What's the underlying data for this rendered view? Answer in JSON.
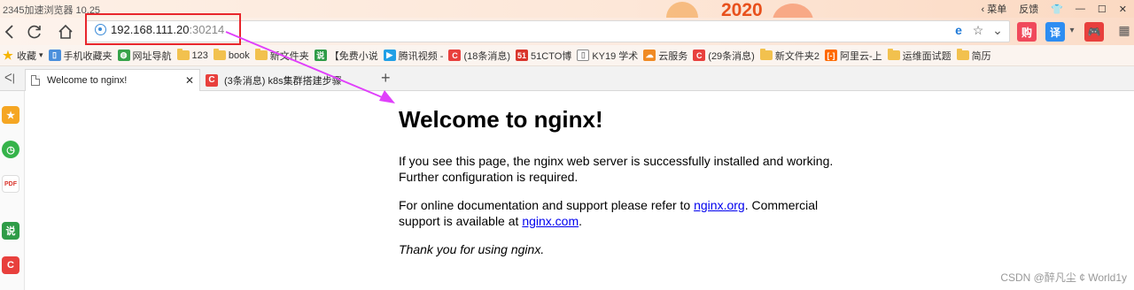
{
  "window": {
    "title": "2345加速浏览器 10.25",
    "banner_year": "2020",
    "menu_label": "菜单",
    "feedback_label": "反馈",
    "controls": [
      "minimize-icon",
      "maximize-icon",
      "close-icon"
    ]
  },
  "address_bar": {
    "url_host": "192.168.111.20",
    "url_port": ":30214"
  },
  "bookmarks": [
    {
      "label": "收藏",
      "icon": "star-icon",
      "color": "#f5b400"
    },
    {
      "label": "手机收藏夹",
      "icon": "phone-icon",
      "color": "#4a8fdc"
    },
    {
      "label": "网址导航",
      "icon": "nav-icon",
      "color": "#37a34a"
    },
    {
      "label": "123",
      "icon": "folder-icon",
      "color": "#f2c14e"
    },
    {
      "label": "book",
      "icon": "folder-icon",
      "color": "#f2c14e"
    },
    {
      "label": "新文件夹",
      "icon": "folder-icon",
      "color": "#f2c14e"
    },
    {
      "label": "【免费小说",
      "icon": "novel-icon",
      "color": "#2f9c48"
    },
    {
      "label": "腾讯视频 -",
      "icon": "video-icon",
      "color": "#21a0e6"
    },
    {
      "label": "(18条消息)",
      "icon": "csdn-icon",
      "color": "#e8403d"
    },
    {
      "label": "51CTO博",
      "icon": "51cto-icon",
      "color": "#d9342b"
    },
    {
      "label": "KY19 学术",
      "icon": "page-icon",
      "color": "#888888"
    },
    {
      "label": "云服务",
      "icon": "cloud-icon",
      "color": "#f08a24"
    },
    {
      "label": "(29条消息)",
      "icon": "csdn-icon",
      "color": "#e8403d"
    },
    {
      "label": "新文件夹2",
      "icon": "folder-icon",
      "color": "#f2c14e"
    },
    {
      "label": "阿里云-上",
      "icon": "aliyun-icon",
      "color": "#ff6a00"
    },
    {
      "label": "运维面试题",
      "icon": "folder-icon",
      "color": "#f2c14e"
    },
    {
      "label": "简历",
      "icon": "folder-icon",
      "color": "#f2c14e"
    }
  ],
  "tabs": [
    {
      "label": "Welcome to nginx!",
      "active": true
    },
    {
      "label": "(3条消息) k8s集群搭建步骤",
      "active": false
    }
  ],
  "page": {
    "heading": "Welcome to nginx!",
    "para1": "If you see this page, the nginx web server is successfully installed and working. Further configuration is required.",
    "para2_before": "For online documentation and support please refer to ",
    "link1": "nginx.org",
    "para2_mid": ". Commercial support is available at ",
    "link2": "nginx.com",
    "para2_end": ".",
    "thanks": "Thank you for using nginx."
  },
  "watermark": "CSDN @醉凡尘 ¢ World1y",
  "annotation": {
    "highlight_color": "#e8262c",
    "arrow_color": "#e040fb"
  }
}
